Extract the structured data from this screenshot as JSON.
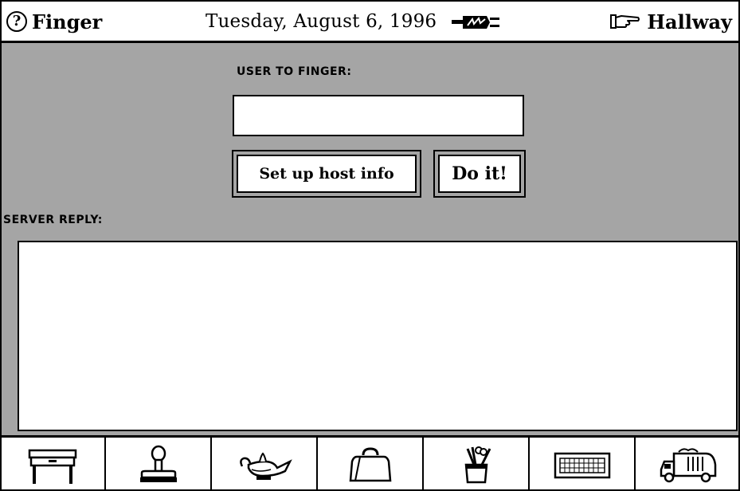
{
  "titlebar": {
    "app_name": "Finger",
    "date": "Tuesday, August 6, 1996",
    "hallway_label": "Hallway",
    "icons": [
      "help-icon",
      "power-plug-icon",
      "pointing-hand-icon"
    ]
  },
  "form": {
    "user_label": "USER TO FINGER:",
    "user_value": "",
    "host_button": "Set up host info",
    "doit_button": "Do it!",
    "reply_label": "SERVER REPLY:",
    "reply_text": ""
  },
  "dock": {
    "items": [
      {
        "icon": "desk-icon"
      },
      {
        "icon": "stamp-icon"
      },
      {
        "icon": "genie-lamp-icon"
      },
      {
        "icon": "bag-icon"
      },
      {
        "icon": "tools-cup-icon"
      },
      {
        "icon": "keyboard-icon"
      },
      {
        "icon": "garbage-truck-icon"
      }
    ]
  },
  "colors": {
    "panel": "#a5a5a5",
    "background": "#ffffff",
    "ink": "#000000"
  }
}
